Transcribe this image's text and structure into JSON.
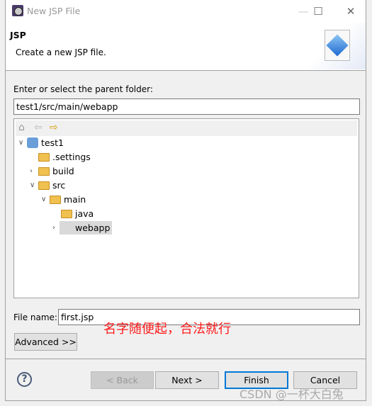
{
  "window": {
    "title": "New JSP File",
    "minimize": "—",
    "maximize": "☐",
    "close": "✕"
  },
  "header": {
    "title": "JSP",
    "description": "Create a new JSP file.",
    "icon": "jsp-file-wizard-icon"
  },
  "folder": {
    "label": "Enter or select the parent folder:",
    "value": "test1/src/main/webapp"
  },
  "tree_toolbar": {
    "home": "⌂",
    "back": "⇦",
    "forward": "⇨"
  },
  "tree": [
    {
      "label": "test1",
      "expanded": true,
      "type": "project"
    },
    {
      "label": ".settings",
      "type": "folder"
    },
    {
      "label": "build",
      "expanded": false,
      "type": "folder"
    },
    {
      "label": "src",
      "expanded": true,
      "type": "folder"
    },
    {
      "label": "main",
      "expanded": true,
      "type": "folder"
    },
    {
      "label": "java",
      "type": "folder"
    },
    {
      "label": "webapp",
      "expanded": false,
      "type": "folder",
      "selected": true
    }
  ],
  "file": {
    "label": "File name:",
    "value": "first.jsp"
  },
  "advanced": "Advanced >>",
  "annotation": "名字随便起，合法就行",
  "buttons": {
    "help": "?",
    "back": "< Back",
    "next": "Next >",
    "finish": "Finish",
    "cancel": "Cancel"
  },
  "watermark": "CSDN @一杯大白兔"
}
